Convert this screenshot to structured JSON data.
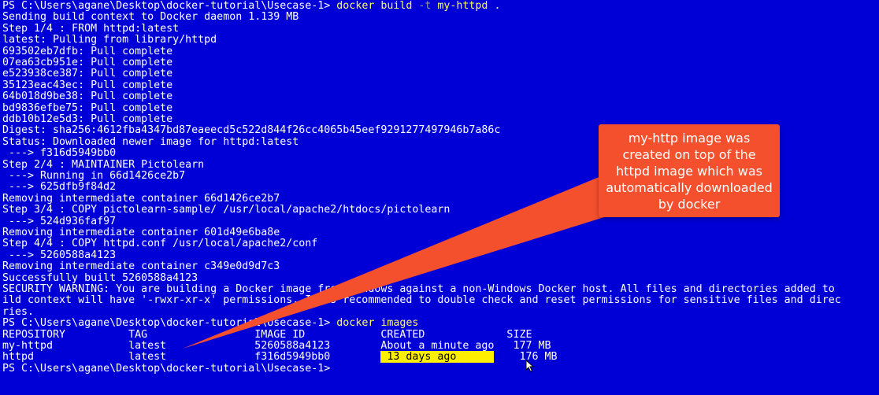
{
  "theme": {
    "background": "#0000d6",
    "text": "#ffffff",
    "command": "#ffff55",
    "flag": "#9a9a9a",
    "highlight": "#ffee00",
    "callout": "#f4502e"
  },
  "terminal": {
    "lines": [
      [
        {
          "t": "PS C:\\Users\\agane\\Desktop\\docker-tutorial\\Usecase-1> "
        },
        {
          "t": "docker build ",
          "c": "cmd"
        },
        {
          "t": "-t",
          "c": "flag"
        },
        {
          "t": " my-httpd .",
          "c": "cmd"
        }
      ],
      [
        {
          "t": "Sending build context to Docker daemon 1.139 MB"
        }
      ],
      [
        {
          "t": "Step 1/4 : FROM httpd:latest"
        }
      ],
      [
        {
          "t": "latest: Pulling from library/httpd"
        }
      ],
      [
        {
          "t": "693502eb7dfb: Pull complete"
        }
      ],
      [
        {
          "t": "07ea63cb951e: Pull complete"
        }
      ],
      [
        {
          "t": "e523938ce387: Pull complete"
        }
      ],
      [
        {
          "t": "35123eac43ec: Pull complete"
        }
      ],
      [
        {
          "t": "64b018d9be38: Pull complete"
        }
      ],
      [
        {
          "t": "bd9836efbe75: Pull complete"
        }
      ],
      [
        {
          "t": "ddb10b12e5d3: Pull complete"
        }
      ],
      [
        {
          "t": "Digest: sha256:4612fba4347bd87eaeecd5c522d844f26cc4065b45eef9291277497946b7a86c"
        }
      ],
      [
        {
          "t": "Status: Downloaded newer image for httpd:latest"
        }
      ],
      [
        {
          "t": " ---> f316d5949bb0"
        }
      ],
      [
        {
          "t": "Step 2/4 : MAINTAINER Pictolearn"
        }
      ],
      [
        {
          "t": " ---> Running in 66d1426ce2b7"
        }
      ],
      [
        {
          "t": " ---> 625dfb9f84d2"
        }
      ],
      [
        {
          "t": "Removing intermediate container 66d1426ce2b7"
        }
      ],
      [
        {
          "t": "Step 3/4 : COPY pictolearn-sample/ /usr/local/apache2/htdocs/pictolearn"
        }
      ],
      [
        {
          "t": " ---> 524d936faf97"
        }
      ],
      [
        {
          "t": "Removing intermediate container 601d49e6ba8e"
        }
      ],
      [
        {
          "t": "Step 4/4 : COPY httpd.conf /usr/local/apache2/conf"
        }
      ],
      [
        {
          "t": " ---> 5260588a4123"
        }
      ],
      [
        {
          "t": "Removing intermediate container c349e0d9d7c3"
        }
      ],
      [
        {
          "t": "Successfully built 5260588a4123"
        }
      ],
      [
        {
          "t": "SECURITY WARNING: You are building a Docker image from Windows against a non-Windows Docker host. All files and directories added to"
        }
      ],
      [
        {
          "t": "ild context will have '-rwxr-xr-x' permissions. It is recommended to double check and reset permissions for sensitive files and direc"
        }
      ],
      [
        {
          "t": "ries."
        }
      ],
      [
        {
          "t": "PS C:\\Users\\agane\\Desktop\\docker-tutorial\\Usecase-1> "
        },
        {
          "t": "docker images",
          "c": "cmd"
        }
      ],
      [
        {
          "t": "REPOSITORY          TAG                 IMAGE ID            CREATED             SIZE"
        }
      ],
      [
        {
          "t": "my-httpd            latest              5260588a4123        About a minute ago   177 MB"
        }
      ],
      [
        {
          "t": "httpd               latest              f316d5949bb0        "
        },
        {
          "t": " 13 days ago      ",
          "c": "hl"
        },
        {
          "t": "    176 MB"
        }
      ],
      [
        {
          "t": "PS C:\\Users\\agane\\Desktop\\docker-tutorial\\Usecase-1>"
        }
      ]
    ]
  },
  "callout": {
    "text": "my-http image was created on top of the httpd image which was automatically downloaded by docker"
  },
  "icons": {
    "cursor": "mouse-pointer-icon"
  }
}
